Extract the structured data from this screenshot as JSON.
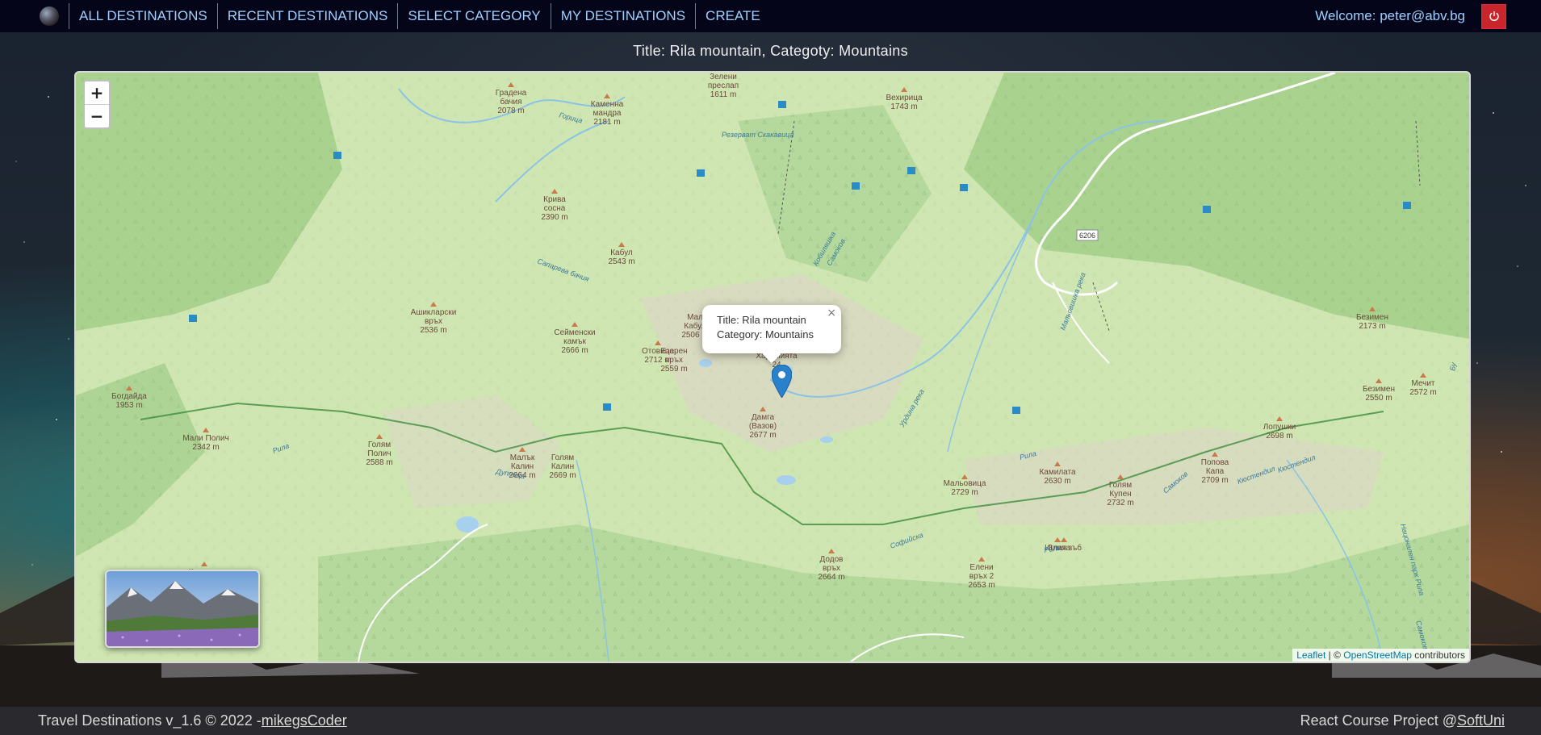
{
  "navbar": {
    "items": [
      {
        "label": "ALL DESTINATIONS"
      },
      {
        "label": "RECENT DESTINATIONS"
      },
      {
        "label": "SELECT CATEGORY"
      },
      {
        "label": "MY DESTINATIONS"
      },
      {
        "label": "CREATE"
      }
    ],
    "welcome": "Welcome: peter@abv.bg"
  },
  "page": {
    "title": "Title: Rila mountain, Categoty: Mountains"
  },
  "map": {
    "zoom_in": "+",
    "zoom_out": "−",
    "popup": {
      "title_line": "Title: Rila mountain",
      "category_line": "Category: Mountains",
      "close": "×"
    },
    "attribution": {
      "leaflet": "Leaflet",
      "separator": " | © ",
      "osm": "OpenStreetMap",
      "suffix": " contributors"
    },
    "labels": [
      {
        "name": "Градена",
        "sub": "бачия",
        "elev": "2078 m"
      },
      {
        "name": "Каменна",
        "sub": "мандра",
        "elev": "2181 m"
      },
      {
        "name": "Зелени",
        "sub": "преслап",
        "elev": "1611 m"
      },
      {
        "name": "Вехирица",
        "sub": "",
        "elev": "1743 m"
      },
      {
        "name": "Крива",
        "sub": "сосна",
        "elev": "2390 m"
      },
      {
        "name": "Кабул",
        "sub": "",
        "elev": "2543 m"
      },
      {
        "name": "Ашикларски",
        "sub": "връх",
        "elev": "2536 m"
      },
      {
        "name": "Сейменски",
        "sub": "камък",
        "elev": "2666 m"
      },
      {
        "name": "Отовица",
        "sub": "",
        "elev": "2712 m"
      },
      {
        "name": "Езерен",
        "sub": "връх",
        "elev": "2559 m"
      },
      {
        "name": "Богдайда",
        "sub": "",
        "elev": "1953 m"
      },
      {
        "name": "Мали Полич",
        "sub": "",
        "elev": "2342 m"
      },
      {
        "name": "Голям",
        "sub": "Полич",
        "elev": "2588 m"
      },
      {
        "name": "Малък",
        "sub": "Калин",
        "elev": "2664 m"
      },
      {
        "name": "Голям",
        "sub": "Калин",
        "elev": "2669 m"
      },
      {
        "name": "Дамга",
        "sub": "(Вазов)",
        "elev": "2677 m"
      },
      {
        "name": "Додов",
        "sub": "връх",
        "elev": "2664 m"
      },
      {
        "name": "Мальовица",
        "sub": "",
        "elev": "2729 m"
      },
      {
        "name": "Елени",
        "sub": "връх 2",
        "elev": "2653 m"
      },
      {
        "name": "Камилата",
        "sub": "",
        "elev": "2630 m"
      },
      {
        "name": "Голям",
        "sub": "Купен",
        "elev": "2732 m"
      },
      {
        "name": "Попова",
        "sub": "Капа",
        "elev": "2709 m"
      },
      {
        "name": "Лопушки",
        "sub": "",
        "elev": "2698 m"
      },
      {
        "name": "Безимен",
        "sub": "",
        "elev": "2173 m"
      },
      {
        "name": "Безимен",
        "sub": "",
        "elev": "2550 m"
      },
      {
        "name": "Мечит",
        "sub": "",
        "elev": "2572 m"
      },
      {
        "name": "Злия зъб",
        "sub": "",
        "elev": ""
      },
      {
        "name": "Иглата",
        "sub": "",
        "elev": ""
      },
      {
        "name": "Караула",
        "sub": "",
        "elev": ""
      },
      {
        "name": "Мал",
        "sub": "Кабул",
        "elev": "2506 m"
      },
      {
        "name": "Харамията",
        "sub": "",
        "elev": "24"
      }
    ],
    "roads": [
      {
        "label": "6206"
      }
    ],
    "rivers": [
      {
        "label": "Рила"
      },
      {
        "label": "Рила"
      },
      {
        "label": "Софийска"
      },
      {
        "label": "Кобиляшка"
      },
      {
        "label": "Горица"
      },
      {
        "label": "Сапарева бачия"
      },
      {
        "label": "Дупница"
      },
      {
        "label": "Урдина река"
      },
      {
        "label": "Мальовишка река"
      },
      {
        "label": "Самоков"
      },
      {
        "label": "Кюстендил"
      },
      {
        "label": "Резерват Скакавица"
      },
      {
        "label": "Самоков"
      },
      {
        "label": "Нацонален парк Рила"
      },
      {
        "label": "Самоков"
      },
      {
        "label": "Бу"
      },
      {
        "label": "Риля"
      },
      {
        "label": "Кюстендил"
      }
    ]
  },
  "footer": {
    "left_text": "Travel Destinations v_1.6 © 2022 -",
    "left_link": "mikegsCoder",
    "right_text": "React Course Project @",
    "right_link": "SoftUni"
  },
  "colors": {
    "navbar_bg": "#050519",
    "nav_text": "#9fd0ff",
    "logout": "#c8262b",
    "marker": "#2a81cb",
    "footer_bg": "#2a2a2e"
  },
  "icons": {
    "logo": "globe-icon",
    "logout": "power-icon",
    "marker": "map-pin-icon"
  }
}
